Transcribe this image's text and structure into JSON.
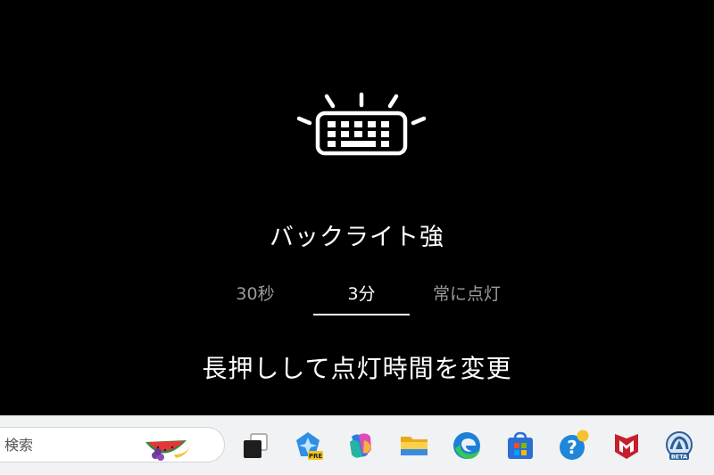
{
  "osd": {
    "title": "バックライト強",
    "options": [
      "30秒",
      "3分",
      "常に点灯"
    ],
    "selected": "3分",
    "hint": "長押しして点灯時間を変更"
  },
  "taskbar": {
    "search_placeholder": "検索",
    "icons": [
      "task-view-icon",
      "copilot-pre-icon",
      "copilot-icon",
      "file-explorer-icon",
      "edge-icon",
      "microsoft-store-icon",
      "help-icon",
      "mcafee-icon",
      "beta-app-icon"
    ]
  },
  "colors": {
    "osd_background": "#000000",
    "text_primary": "#ffffff",
    "text_inactive": "#9a9a9a",
    "taskbar_background": "#f0f2f4"
  }
}
